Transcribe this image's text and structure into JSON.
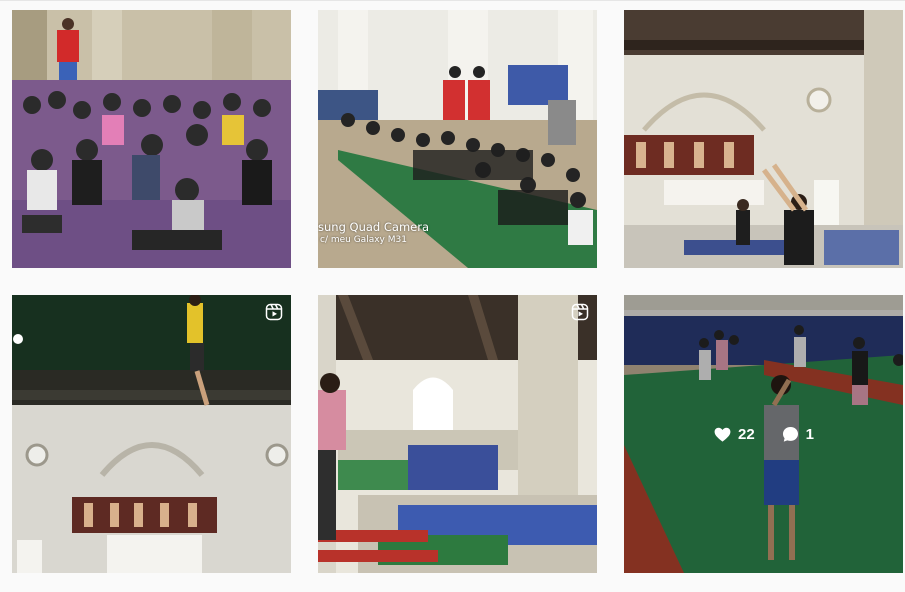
{
  "camera_watermark": {
    "line1": "sung Quad Camera",
    "line2": "c/ meu Galaxy M31"
  },
  "hovered_post": {
    "likes": "22",
    "comments": "1"
  },
  "icons": {
    "reel": "reel-icon",
    "like": "heart-icon",
    "comment": "comment-bubble-icon"
  },
  "colors": {
    "background": "#fafafa",
    "overlay_text": "#ffffff"
  }
}
